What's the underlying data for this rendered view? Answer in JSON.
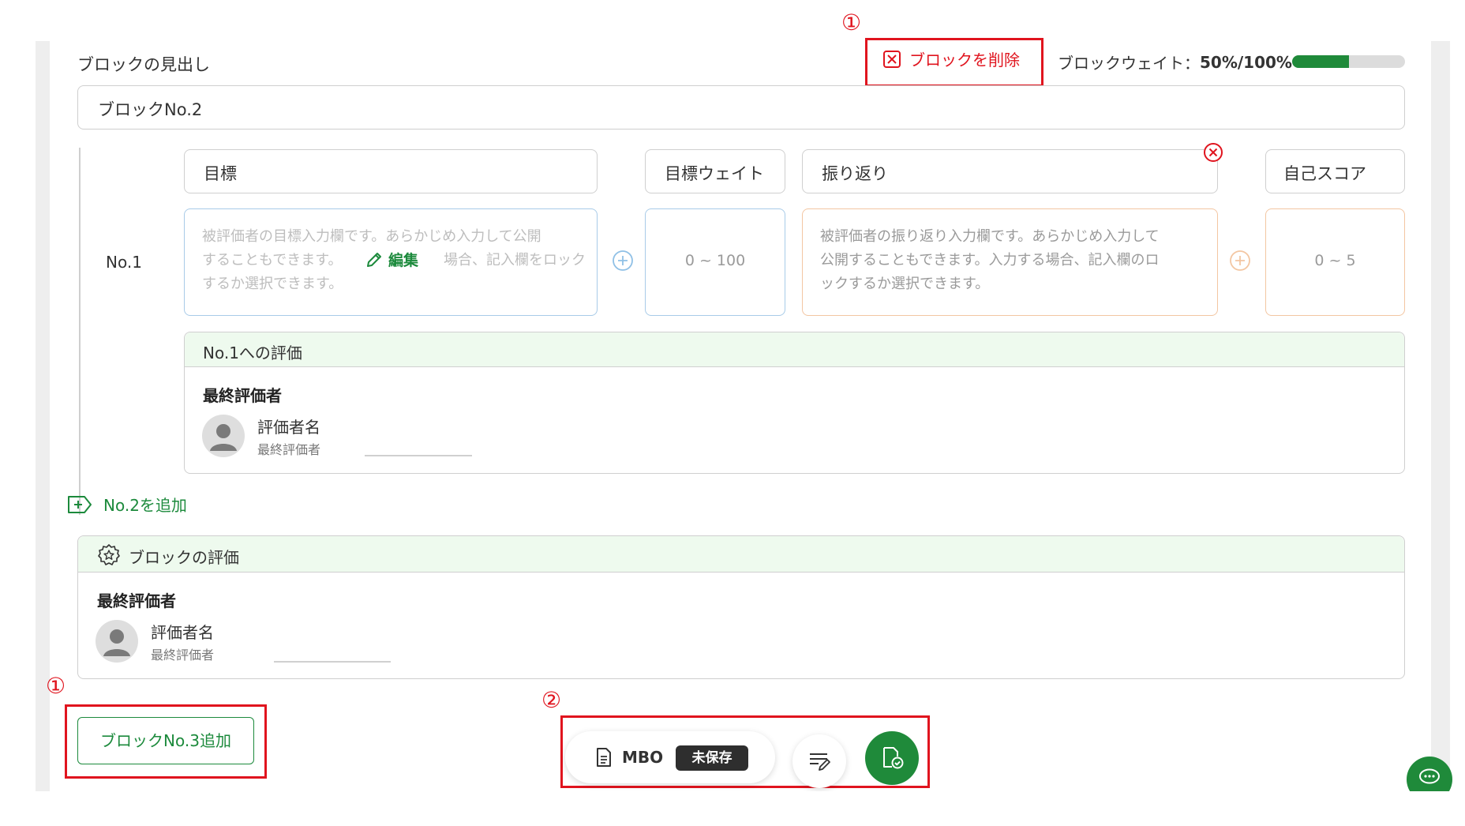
{
  "annotations": {
    "marker_1": "①",
    "marker_2": "②"
  },
  "block": {
    "heading_label": "ブロックの見出し",
    "heading_value": "ブロックNo.2",
    "delete_label": "ブロックを削除",
    "weight_label": "ブロックウェイト：",
    "weight_value": "50%/100%",
    "weight_fraction": 0.5
  },
  "columns": {
    "goal": "目標",
    "goal_weight": "目標ウェイト",
    "reflection": "振り返り",
    "self_score": "自己スコア"
  },
  "row1": {
    "label": "No.1",
    "goal_placeholder_1": "被評価者の目標入力欄です。あらかじめ入力して公開",
    "goal_placeholder_2": "することもできます。",
    "goal_placeholder_2b": "場合、記入欄をロック",
    "goal_placeholder_3": "するか選択できます。",
    "edit_label": "編集",
    "weight_placeholder": "0 ~ 100",
    "reflection_placeholder_1": "被評価者の振り返り入力欄です。あらかじめ入力して",
    "reflection_placeholder_2": "公開することもできます。入力する場合、記入欄のロ",
    "reflection_placeholder_3": "ックするか選択できます。",
    "score_placeholder": "0 ~ 5"
  },
  "eval_row1": {
    "title": "No.1への評価",
    "final_evaluator": "最終評価者",
    "evaluator_name": "評価者名",
    "evaluator_role": "最終評価者"
  },
  "add_row_label": "No.2を追加",
  "block_eval": {
    "title": "ブロックの評価",
    "final_evaluator": "最終評価者",
    "evaluator_name": "評価者名",
    "evaluator_role": "最終評価者"
  },
  "add_block_label": "ブロックNo.3追加",
  "toolbar": {
    "doc_label": "MBO",
    "status_badge": "未保存"
  },
  "colors": {
    "accent_green": "#1f8a3a",
    "annotation_red": "#e0141e",
    "goal_border": "#a8cbe8",
    "reflection_border": "#f3c6a2"
  }
}
